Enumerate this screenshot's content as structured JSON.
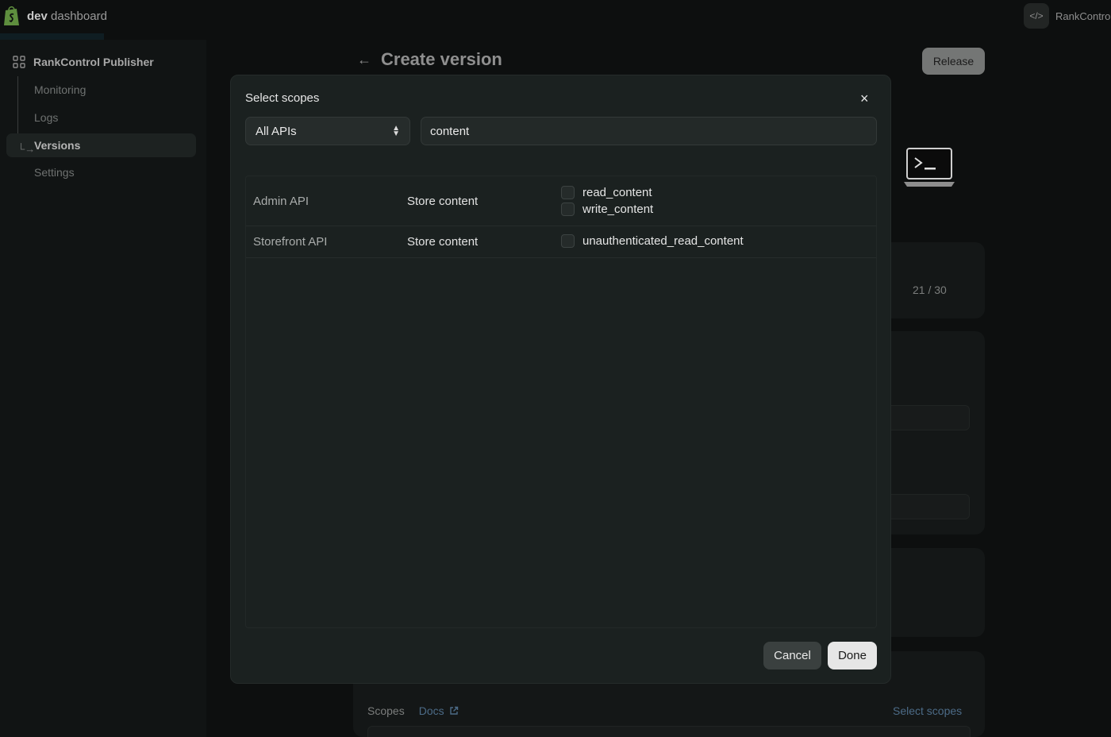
{
  "topbar": {
    "brand_bold": "dev",
    "brand_rest": " dashboard",
    "store_name": "RankContro"
  },
  "sidebar": {
    "app_name": "RankControl Publisher",
    "items": [
      {
        "label": "Monitoring"
      },
      {
        "label": "Logs"
      },
      {
        "label": "Versions"
      },
      {
        "label": "Settings"
      }
    ]
  },
  "page": {
    "title": "Create version",
    "release_label": "Release",
    "counter": "21 / 30",
    "scopes_label": "Scopes",
    "docs_label": "Docs",
    "select_scopes_link": "Select scopes"
  },
  "modal": {
    "title": "Select scopes",
    "close_glyph": "×",
    "api_select_value": "All APIs",
    "search_value": "content",
    "rows": [
      {
        "api": "Admin API",
        "group": "Store content",
        "scopes": [
          "read_content",
          "write_content"
        ]
      },
      {
        "api": "Storefront API",
        "group": "Store content",
        "scopes": [
          "unauthenticated_read_content"
        ]
      }
    ],
    "cancel_label": "Cancel",
    "done_label": "Done"
  },
  "colors": {
    "background": "#0d0f0f",
    "modal": "#1b2120",
    "primary_button": "#e6e6e6",
    "link": "#4c6b87"
  }
}
